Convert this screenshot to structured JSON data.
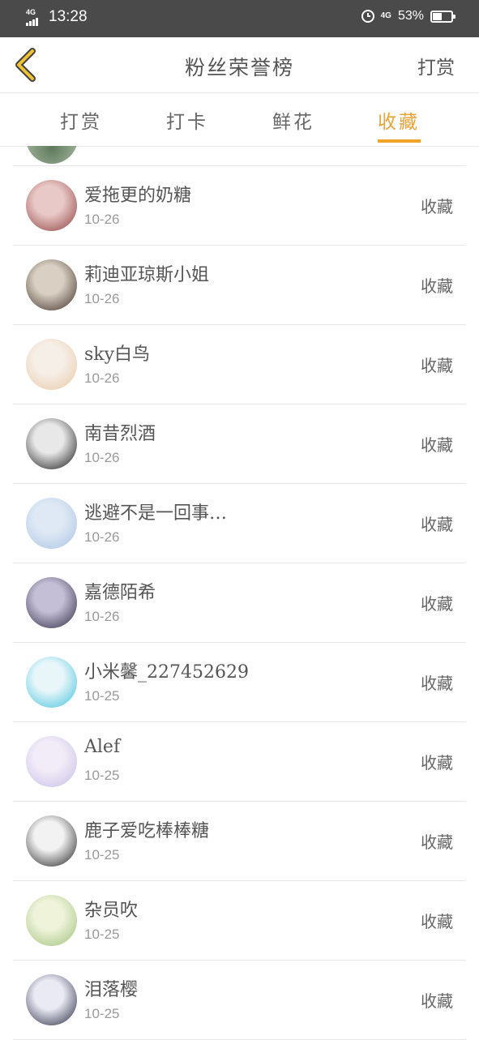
{
  "status_bar": {
    "network_left": "4G",
    "time": "13:28",
    "network_right": "4G",
    "battery_percent": "53%",
    "battery_level": 0.53
  },
  "header": {
    "title": "粉丝荣誉榜",
    "right_button": "打赏"
  },
  "tabs": [
    {
      "label": "打赏",
      "active": false
    },
    {
      "label": "打卡",
      "active": false
    },
    {
      "label": "鲜花",
      "active": false
    },
    {
      "label": "收藏",
      "active": true
    }
  ],
  "accent_color": "#f0a324",
  "list": [
    {
      "name": "爱拖更的奶糖",
      "date": "10-26",
      "action": "收藏",
      "avatar_colors": [
        "#e9c9c7",
        "#8a3b3b"
      ]
    },
    {
      "name": "莉迪亚琼斯小姐",
      "date": "10-26",
      "action": "收藏",
      "avatar_colors": [
        "#d9cfc2",
        "#3a2a24"
      ]
    },
    {
      "name": "sky白鸟",
      "date": "10-26",
      "action": "收藏",
      "avatar_colors": [
        "#f6efe8",
        "#e9c7a6"
      ]
    },
    {
      "name": "南昔烈酒",
      "date": "10-26",
      "action": "收藏",
      "avatar_colors": [
        "#e8e8e8",
        "#111111"
      ]
    },
    {
      "name": "逃避不是一回事…",
      "date": "10-26",
      "action": "收藏",
      "avatar_colors": [
        "#dfe9f5",
        "#a9c3e4"
      ]
    },
    {
      "name": "嘉德陌希",
      "date": "10-26",
      "action": "收藏",
      "avatar_colors": [
        "#c4bfd6",
        "#2b2740"
      ]
    },
    {
      "name": "小米馨_227452629",
      "date": "10-25",
      "action": "收藏",
      "avatar_colors": [
        "#e8f6fa",
        "#3fc0dc"
      ]
    },
    {
      "name": "Alef",
      "date": "10-25",
      "action": "收藏",
      "avatar_colors": [
        "#f1ecf8",
        "#c8bde6"
      ]
    },
    {
      "name": "鹿子爱吃棒棒糖",
      "date": "10-25",
      "action": "收藏",
      "avatar_colors": [
        "#f2f2f2",
        "#1a1a1a"
      ]
    },
    {
      "name": "杂员吹",
      "date": "10-25",
      "action": "收藏",
      "avatar_colors": [
        "#eef3da",
        "#9fbf7a"
      ]
    },
    {
      "name": "泪落樱",
      "date": "10-25",
      "action": "收藏",
      "avatar_colors": [
        "#eaeaf5",
        "#1f2238"
      ]
    }
  ]
}
